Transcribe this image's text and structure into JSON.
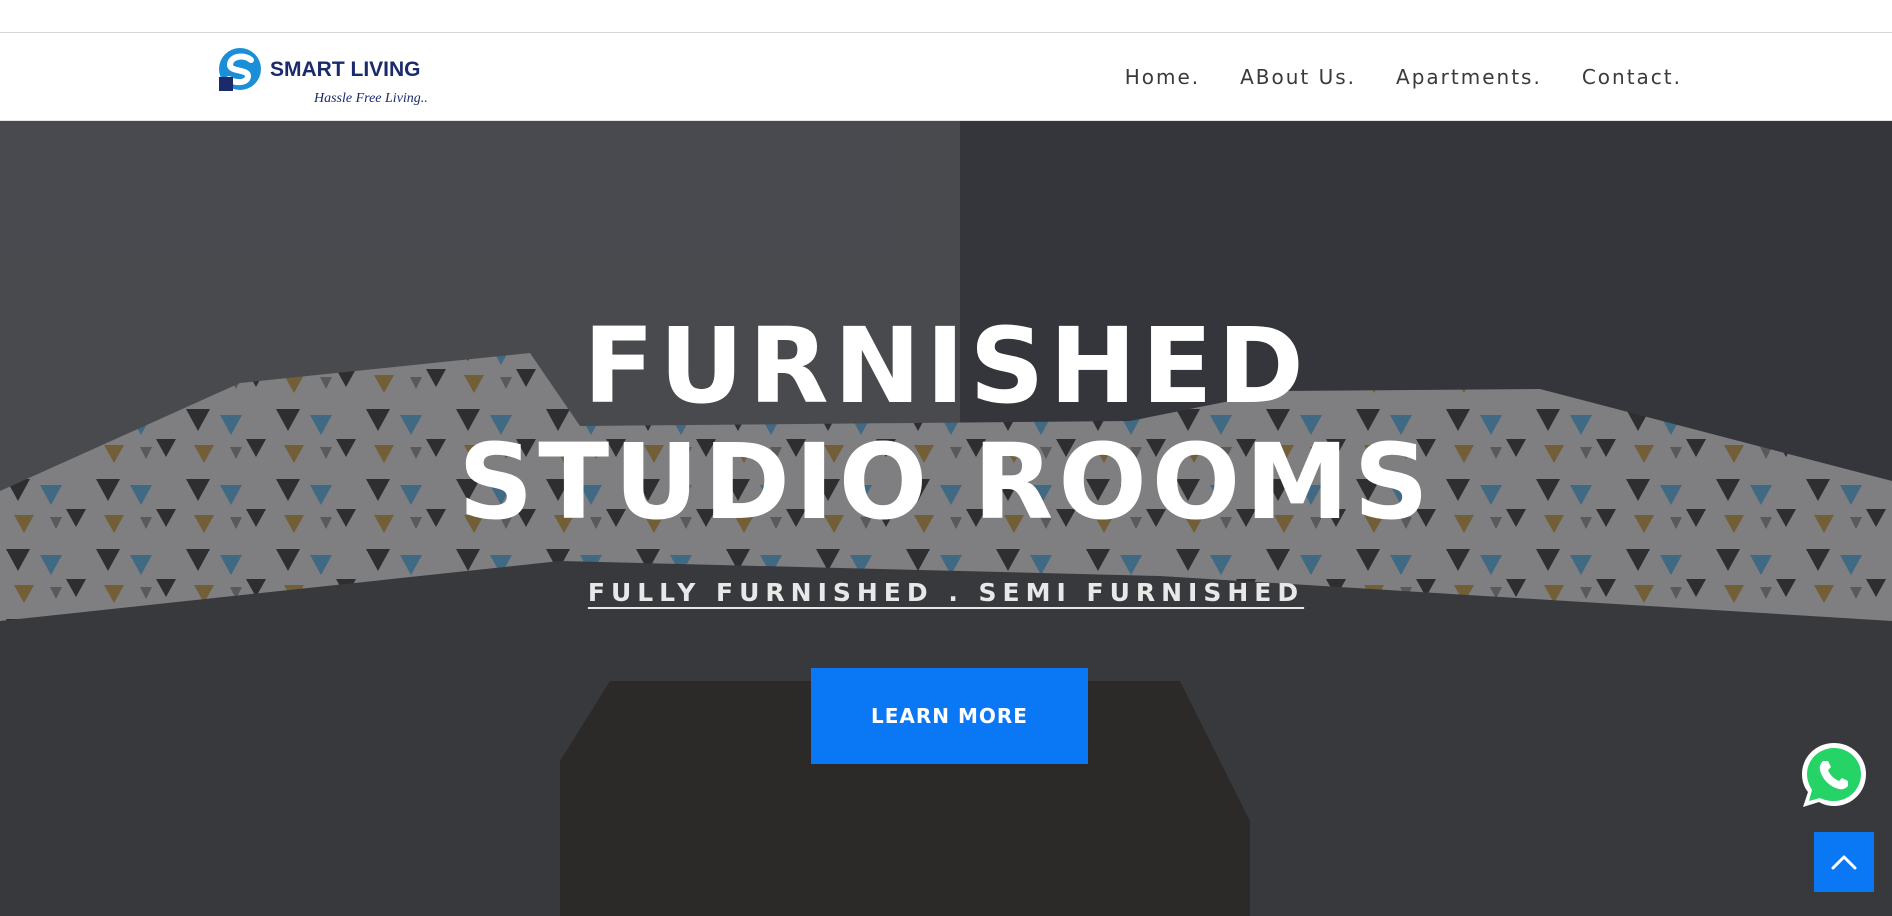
{
  "brand": {
    "name": "SMART LIVING",
    "tagline": "Hassle Free Living..."
  },
  "nav": {
    "items": [
      {
        "label": "Home."
      },
      {
        "label": "ABout Us."
      },
      {
        "label": "Apartments."
      },
      {
        "label": "Contact."
      }
    ]
  },
  "hero": {
    "title_line1": "FURNISHED",
    "title_line2": "STUDIO ROOMS",
    "subtitle": "FULLY FURNISHED . SEMI FURNISHED",
    "cta_label": "LEARN MORE"
  },
  "colors": {
    "accent": "#0a78f5",
    "logo_blue": "#1a8fd8",
    "logo_navy": "#1b2a6b",
    "whatsapp_green": "#25d366"
  },
  "icons": {
    "whatsapp": "whatsapp-icon",
    "back_to_top": "chevron-up-icon"
  }
}
